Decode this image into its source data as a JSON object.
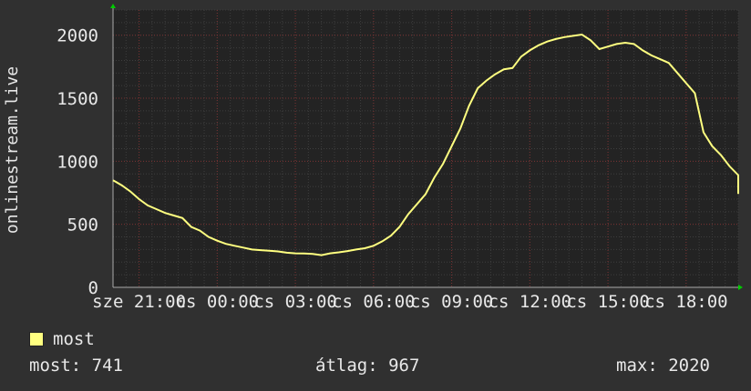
{
  "chart_data": {
    "type": "line",
    "ylabel": "onlinestream.live",
    "yticks": [
      0,
      500,
      1000,
      1500,
      2000
    ],
    "ylim": [
      0,
      2200
    ],
    "xlim": [
      0,
      86400
    ],
    "xticks": [
      {
        "t": 3600,
        "label": "sze 21:00"
      },
      {
        "t": 14400,
        "label": "cs 00:00"
      },
      {
        "t": 25200,
        "label": "cs 03:00"
      },
      {
        "t": 36000,
        "label": "cs 06:00"
      },
      {
        "t": 46800,
        "label": "cs 09:00"
      },
      {
        "t": 57600,
        "label": "cs 12:00"
      },
      {
        "t": 68400,
        "label": "cs 15:00"
      },
      {
        "t": 79200,
        "label": "cs 18:00"
      }
    ],
    "grid": true,
    "series": [
      {
        "name": "most",
        "color": "#ffff80",
        "points": [
          [
            0,
            850
          ],
          [
            1200,
            810
          ],
          [
            2400,
            760
          ],
          [
            3600,
            700
          ],
          [
            4800,
            650
          ],
          [
            6000,
            620
          ],
          [
            7200,
            590
          ],
          [
            8400,
            570
          ],
          [
            9600,
            550
          ],
          [
            10800,
            480
          ],
          [
            12000,
            450
          ],
          [
            13200,
            400
          ],
          [
            14400,
            370
          ],
          [
            15600,
            345
          ],
          [
            16800,
            330
          ],
          [
            18000,
            315
          ],
          [
            19200,
            300
          ],
          [
            20400,
            295
          ],
          [
            21600,
            290
          ],
          [
            22800,
            285
          ],
          [
            24000,
            275
          ],
          [
            25200,
            270
          ],
          [
            26400,
            268
          ],
          [
            27600,
            265
          ],
          [
            28800,
            255
          ],
          [
            30000,
            270
          ],
          [
            31200,
            278
          ],
          [
            32400,
            288
          ],
          [
            33600,
            300
          ],
          [
            34800,
            310
          ],
          [
            36000,
            330
          ],
          [
            37200,
            365
          ],
          [
            38400,
            410
          ],
          [
            39600,
            480
          ],
          [
            40800,
            580
          ],
          [
            42000,
            660
          ],
          [
            43200,
            740
          ],
          [
            44400,
            870
          ],
          [
            45600,
            980
          ],
          [
            46800,
            1120
          ],
          [
            48000,
            1260
          ],
          [
            49200,
            1440
          ],
          [
            50400,
            1580
          ],
          [
            51600,
            1640
          ],
          [
            52800,
            1690
          ],
          [
            54000,
            1730
          ],
          [
            55200,
            1740
          ],
          [
            56400,
            1830
          ],
          [
            57600,
            1880
          ],
          [
            58800,
            1920
          ],
          [
            60000,
            1950
          ],
          [
            61200,
            1970
          ],
          [
            62400,
            1985
          ],
          [
            63600,
            1995
          ],
          [
            64800,
            2005
          ],
          [
            66000,
            1960
          ],
          [
            67200,
            1890
          ],
          [
            68400,
            1910
          ],
          [
            69600,
            1930
          ],
          [
            70800,
            1940
          ],
          [
            72000,
            1930
          ],
          [
            73200,
            1880
          ],
          [
            74400,
            1840
          ],
          [
            75600,
            1810
          ],
          [
            76800,
            1780
          ],
          [
            78000,
            1700
          ],
          [
            79200,
            1620
          ],
          [
            80400,
            1540
          ],
          [
            81600,
            1230
          ],
          [
            82800,
            1120
          ],
          [
            84000,
            1050
          ],
          [
            85200,
            960
          ],
          [
            86400,
            890
          ],
          [
            87600,
            850
          ],
          [
            88800,
            780
          ],
          [
            90000,
            741
          ]
        ]
      }
    ]
  },
  "legend": {
    "label": "most",
    "color": "#ffff80"
  },
  "stats": {
    "now": "most: 741",
    "avg": "átlag: 967",
    "max": "max: 2020"
  }
}
